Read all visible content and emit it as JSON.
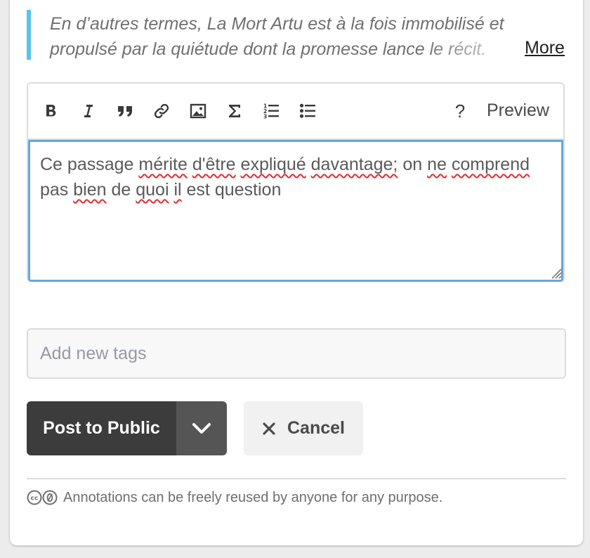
{
  "quote": {
    "line1": "En d’autres termes, La Mort Artu est à la fois immobilisé et",
    "line2": "propulsé par la quiétude dont la promesse lance le récit.",
    "more_label": "More",
    "accent_color": "#58c4ec"
  },
  "toolbar": {
    "buttons": [
      {
        "name": "bold",
        "icon": "bold-icon"
      },
      {
        "name": "italic",
        "icon": "italic-icon"
      },
      {
        "name": "blockquote",
        "icon": "quote-icon"
      },
      {
        "name": "link",
        "icon": "link-icon"
      },
      {
        "name": "image",
        "icon": "image-icon"
      },
      {
        "name": "math",
        "icon": "sigma-icon"
      },
      {
        "name": "numbered-list",
        "icon": "numbered-list-icon"
      },
      {
        "name": "bulleted-list",
        "icon": "bulleted-list-icon"
      }
    ],
    "help_label": "?",
    "preview_label": "Preview"
  },
  "editor": {
    "words": [
      "Ce",
      "passage",
      "mérite",
      "d'être",
      "expliqué",
      "davantage;",
      "on",
      "ne",
      "comprend",
      "pas",
      "bien",
      "de",
      "quoi",
      "il",
      "est",
      "question"
    ],
    "misspelled_indices": [
      2,
      3,
      4,
      5,
      7,
      8,
      10,
      12,
      13
    ],
    "focus_color": "#65a7e0"
  },
  "tags": {
    "placeholder": "Add new tags"
  },
  "actions": {
    "post_label": "Post to Public",
    "cancel_label": "Cancel",
    "post_color": "#3c3c3c",
    "post_caret_color": "#555555"
  },
  "footer": {
    "license_text": "Annotations can be freely reused by anyone for any purpose."
  }
}
